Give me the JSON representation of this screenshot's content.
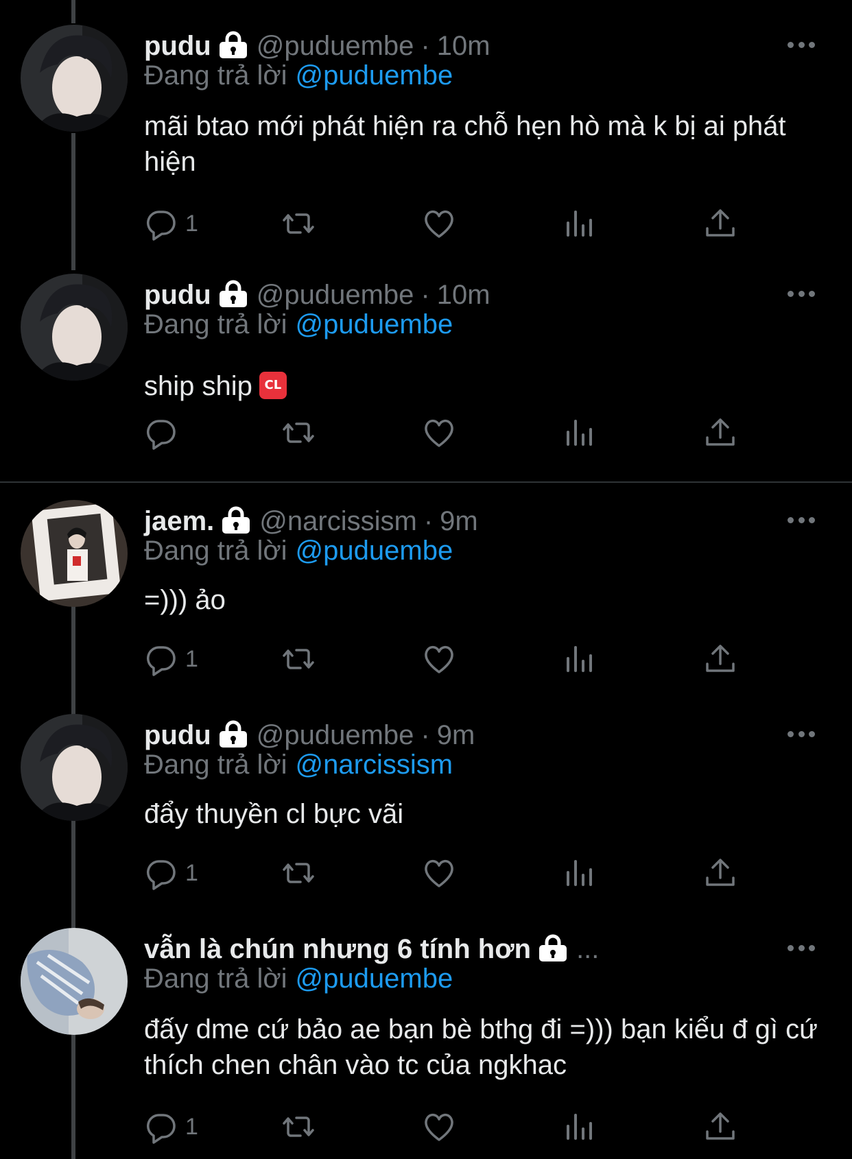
{
  "colors": {
    "background": "#000000",
    "text": "#e7e9ea",
    "muted": "#71767b",
    "link": "#1d9bf0",
    "separator": "#2f3336"
  },
  "tweets": [
    {
      "name": "pudu",
      "handle": "@puduembe",
      "dot": "·",
      "time": "10m",
      "reply_prefix": "Đang trả lời",
      "reply_to": "@puduembe",
      "text": "mãi btao mới phát hiện ra chỗ hẹn hò mà k bị ai phát hiện",
      "reply_count": "1"
    },
    {
      "name": "pudu",
      "handle": "@puduembe",
      "dot": "·",
      "time": "10m",
      "reply_prefix": "Đang trả lời",
      "reply_to": "@puduembe",
      "text": "ship ship",
      "emoji": "CL",
      "reply_count": ""
    },
    {
      "name": "jaem.",
      "handle": "@narcissism",
      "dot": "·",
      "time": "9m",
      "reply_prefix": "Đang trả lời",
      "reply_to": "@puduembe",
      "text": "=))) ảo",
      "reply_count": "1"
    },
    {
      "name": "pudu",
      "handle": "@puduembe",
      "dot": "·",
      "time": "9m",
      "reply_prefix": "Đang trả lời",
      "reply_to": "@narcissism",
      "text": "đẩy thuyền cl bực vãi",
      "reply_count": "1"
    },
    {
      "name": "vẫn là chún nhưng 6 tính hơn",
      "handle": "...",
      "reply_prefix": "Đang trả lời",
      "reply_to": "@puduembe",
      "text": "đấy dme cứ bảo ae bạn bè bthg đi =))) bạn kiểu đ gì cứ thích chen chân vào tc của ngkhac",
      "reply_count": "1"
    }
  ],
  "icons": [
    "lock-icon",
    "more-icon",
    "reply-icon",
    "retweet-icon",
    "like-icon",
    "views-icon",
    "share-icon"
  ]
}
